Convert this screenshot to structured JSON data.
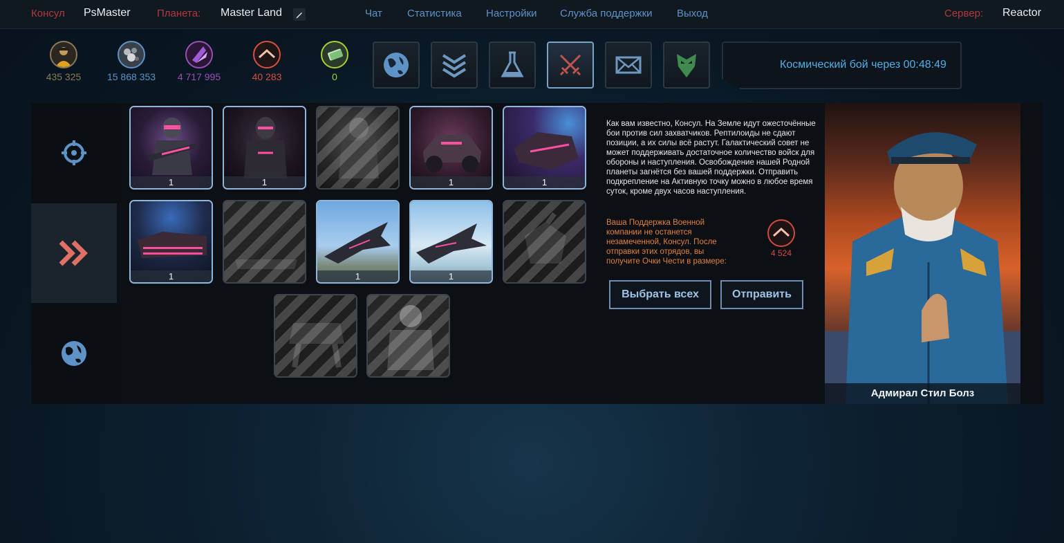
{
  "header": {
    "consul_label": "Консул",
    "consul_name": "PsMaster",
    "planet_label": "Планета:",
    "planet_name": "Master Land",
    "nav": [
      "Чат",
      "Статистика",
      "Настройки",
      "Служба поддержки",
      "Выход"
    ],
    "server_label": "Сервер:",
    "server_name": "Reactor"
  },
  "resources": [
    {
      "name": "population",
      "icon": "consul-avatar-icon",
      "value": "435 325",
      "color": "#8a7a55"
    },
    {
      "name": "metal",
      "icon": "metal-icon",
      "value": "15 868 353",
      "color": "#5e93c8"
    },
    {
      "name": "crystal",
      "icon": "crystal-icon",
      "value": "4 717 995",
      "color": "#9b4fb5"
    },
    {
      "name": "honor",
      "icon": "honor-icon",
      "value": "40 283",
      "color": "#d9503f"
    },
    {
      "name": "credits",
      "icon": "credits-icon",
      "value": "0",
      "color": "#a6d12f"
    }
  ],
  "tabs": [
    {
      "icon": "planet-icon",
      "active": false
    },
    {
      "icon": "ranks-icon",
      "active": false
    },
    {
      "icon": "flask-icon",
      "active": false
    },
    {
      "icon": "crossed-swords-icon",
      "active": true
    },
    {
      "icon": "mail-icon",
      "active": false
    },
    {
      "icon": "alliance-icon",
      "active": false
    }
  ],
  "timer": {
    "text": "Космический бой через 00:48:49"
  },
  "sidebar": [
    {
      "icon": "crosshair-icon",
      "active": false
    },
    {
      "icon": "double-chevron-icon",
      "active": true
    },
    {
      "icon": "globe-icon",
      "active": false
    }
  ],
  "units": [
    {
      "name": "trooper",
      "count": "1",
      "locked": false
    },
    {
      "name": "heavy-trooper",
      "count": "1",
      "locked": false
    },
    {
      "name": "sniper",
      "count": "",
      "locked": true
    },
    {
      "name": "buggy",
      "count": "1",
      "locked": false
    },
    {
      "name": "hover-tank",
      "count": "1",
      "locked": false
    },
    {
      "name": "heavy-tank",
      "count": "1",
      "locked": false
    },
    {
      "name": "artillery",
      "count": "",
      "locked": true
    },
    {
      "name": "fighter",
      "count": "1",
      "locked": false
    },
    {
      "name": "bomber",
      "count": "1",
      "locked": false
    },
    {
      "name": "mech",
      "count": "",
      "locked": true
    },
    {
      "name": "walker",
      "count": "",
      "locked": true
    },
    {
      "name": "exo-suit",
      "count": "",
      "locked": true
    }
  ],
  "description": "Как вам известно, Консул. На Земле идут ожесточённые бои против сил захватчиков. Рептилоиды не сдают позиции, а их силы всё растут. Галактический совет не может поддерживать достаточное количество войск для обороны и наступления. Освобождение нашей Родной планеты загнётся без вашей поддержки. Отправить подкрепление на Активную точку можно в любое время суток, кроме двух часов наступления.",
  "reward_text": "Ваша Поддержка Военной компании не останется незамеченной, Консул. После отправки этих отрядов, вы получите Очки Чести в размере:",
  "reward_value": "4 524",
  "buttons": {
    "select_all": "Выбрать всех",
    "send": "Отправить"
  },
  "portrait": {
    "name": "Адмирал Стил Болз"
  }
}
